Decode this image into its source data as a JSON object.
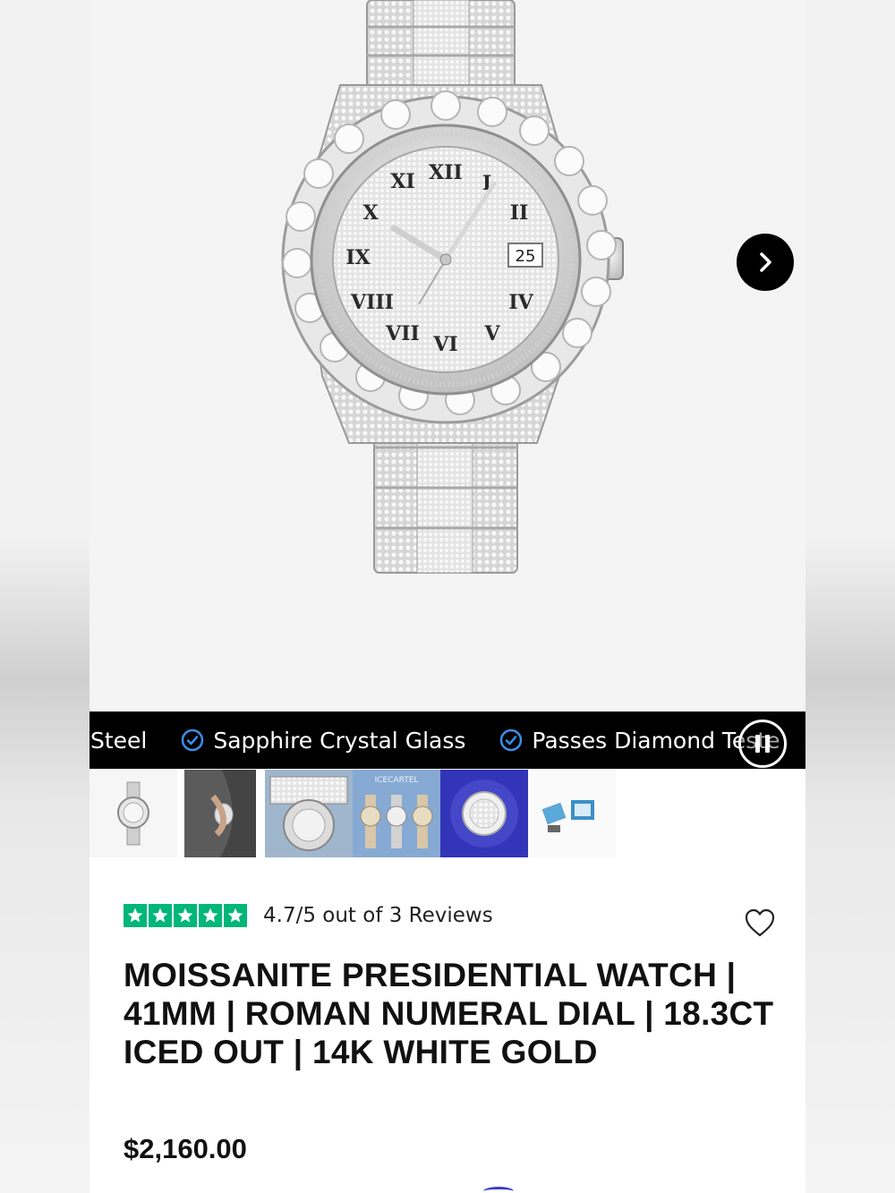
{
  "ticker": {
    "items": [
      {
        "label": "Stainless Steel",
        "visible": "s Steel"
      },
      {
        "label": "Sapphire Crystal Glass",
        "visible": "Sapphire Crystal Glass"
      },
      {
        "label": "Passes Diamond Tester",
        "visible": "Passes Diamond Teste"
      }
    ]
  },
  "hero": {
    "image_icon": "watch-image",
    "next_icon": "chevron-right-icon",
    "dial_date": "25"
  },
  "thumbnails": [
    {
      "name": "thumb-watch-front"
    },
    {
      "name": "thumb-watch-wrist"
    },
    {
      "name": "thumb-watch-caseback"
    },
    {
      "name": "thumb-watch-lineup"
    },
    {
      "name": "thumb-watch-blue"
    },
    {
      "name": "thumb-watch-box"
    }
  ],
  "rating": {
    "stars": 5,
    "text": "4.7/5 out of 3 Reviews",
    "color": "#00b67a"
  },
  "product": {
    "title": "MOISSANITE PRESIDENTIAL WATCH | 41MM | ROMAN NUMERAL DIAL | 18.3CT ICED OUT | 14K WHITE GOLD",
    "price": "$2,160.00"
  }
}
